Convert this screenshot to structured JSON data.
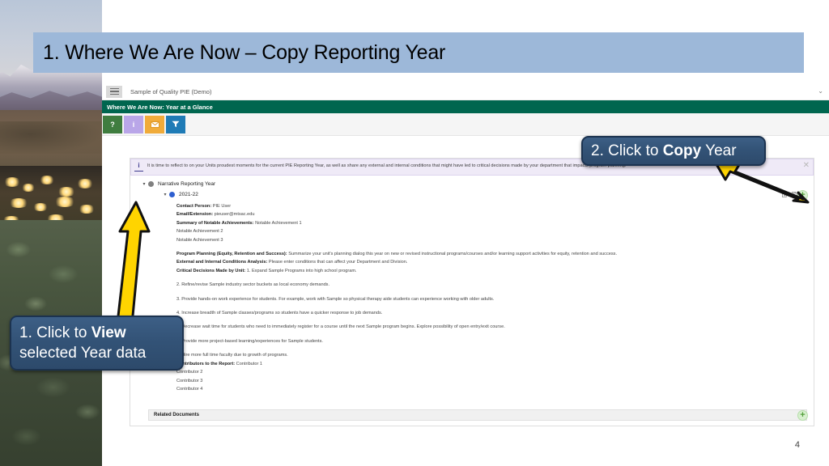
{
  "slide": {
    "title": "1. Where We Are Now – Copy Reporting Year",
    "page_number": "4",
    "title_bar_color": "#9db8d9"
  },
  "app": {
    "menu_icon": "hamburger-icon",
    "window_title": "Sample of Quality PIE (Demo)",
    "collapse_icon": "chevron-down-icon",
    "section_banner": "Where We Are Now: Year at a Glance",
    "banner_color": "#00664f",
    "toolbar": [
      {
        "name": "help-button",
        "glyph": "?",
        "color": "#3f7d3f"
      },
      {
        "name": "info-button",
        "glyph": "i",
        "color": "#b9a6e8"
      },
      {
        "name": "mail-button",
        "glyph": "envelope-icon",
        "color": "#f0ab3a"
      },
      {
        "name": "filter-button",
        "glyph": "funnel-icon",
        "color": "#1f7bb6"
      }
    ]
  },
  "notice": {
    "icon": "info-icon",
    "text": "It is time to reflect to on your Units proudest moments for the current PIE Reporting Year, as well as share any external and internal conditions that might have led to critical decisions made by your department that impacts program planning.",
    "close_label": "✕"
  },
  "tree": {
    "root": {
      "label": "Narrative Reporting Year",
      "caret": "▾",
      "dot_color": "#808080"
    },
    "child": {
      "label": "2021-22",
      "caret": "▾",
      "dot_color": "#2e5fd0"
    }
  },
  "row_actions": [
    {
      "name": "edit-icon",
      "title": "Edit"
    },
    {
      "name": "copy-icon",
      "title": "Copy"
    },
    {
      "name": "delete-icon",
      "title": "Delete"
    }
  ],
  "add_buttons": {
    "top_label": "+",
    "bottom_label": "+"
  },
  "detail": {
    "lines": [
      {
        "label": "Contact Person:",
        "value": " PIE User"
      },
      {
        "label": "Email/Extension:",
        "value": " pieuser@mtsac.edu"
      },
      {
        "label": "Summary of Notable Achievements:",
        "value": " Notable Achievement 1"
      },
      {
        "label": "",
        "value": "Notable Achievement 2"
      },
      {
        "label": "",
        "value": "Notable Achievement 3"
      }
    ],
    "lines2": [
      {
        "label": "Program Planning (Equity, Retention and Success):",
        "value": " Summarize your unit's planning dialog this year on new or revised instructional programs/courses and/or learning support activities for equity, retention and success."
      },
      {
        "label": "External and Internal Conditions Analysis:",
        "value": " Please enter conditions that can affect your Department and Division."
      },
      {
        "label": "Critical Decisions Made by Unit:",
        "value": " 1. Expand Sample Programs into high school program."
      }
    ],
    "numbered": [
      "2. Refine/revise Sample industry sector buckets as local economy demands.",
      "3. Provide hands-on work experience for students.  For example, work with Sample so physical therapy aide students can experience working with older adults.",
      "4. Increase breadth of Sample classes/programs so students have a quicker response to job demands.",
      "5. Decrease wait time for students who need to immediately register for a course until the next Sample program begins. Explore possibility of open entry/exit course.",
      "6. Provide more project-based learning/experiences for Sample students.",
      "7. Hire more full time faculty due to growth of programs."
    ],
    "contributors": [
      {
        "label": "Contributors to the Report:",
        "value": " Contributor 1"
      },
      {
        "label": "",
        "value": "Contributor 2"
      },
      {
        "label": "",
        "value": "Contributor 3"
      },
      {
        "label": "",
        "value": "Contributor 4"
      }
    ],
    "related_documents": "Related Documents"
  },
  "callouts": {
    "one": {
      "line1_prefix": "1. Click to ",
      "line1_bold": "View",
      "line2": "selected Year data"
    },
    "two": {
      "prefix": "2. Click to ",
      "bold": "Copy",
      "suffix": " Year"
    }
  }
}
